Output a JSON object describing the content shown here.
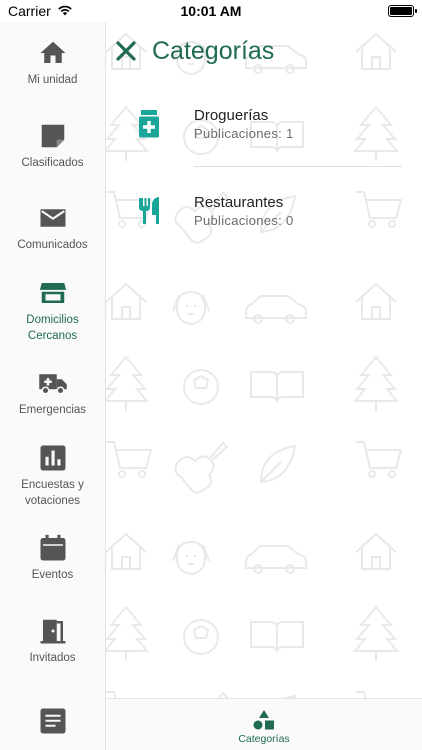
{
  "status_bar": {
    "carrier": "Carrier",
    "time": "10:01 AM",
    "battery_percent": 100
  },
  "sidebar": {
    "items": [
      {
        "label": "Mi unidad",
        "icon": "home-icon",
        "active": false
      },
      {
        "label": "Clasificados",
        "icon": "note-icon",
        "active": false
      },
      {
        "label": "Comunicados",
        "icon": "mail-icon",
        "active": false
      },
      {
        "label": "Domicilios Cercanos",
        "icon": "store-icon",
        "active": true
      },
      {
        "label": "Emergencias",
        "icon": "ambulance-icon",
        "active": false
      },
      {
        "label": "Encuestas y votaciones",
        "icon": "bar-chart-icon",
        "active": false
      },
      {
        "label": "Eventos",
        "icon": "calendar-icon",
        "active": false
      },
      {
        "label": "Invitados",
        "icon": "door-icon",
        "active": false
      },
      {
        "label": "",
        "icon": "document-icon",
        "active": false
      }
    ]
  },
  "header": {
    "title": "Categorías",
    "close_icon": "close-icon"
  },
  "categories": [
    {
      "name": "Droguerías",
      "count_text": "Publicaciones: 1",
      "icon": "pharmacy-icon"
    },
    {
      "name": "Restaurantes",
      "count_text": "Publicaciones: 0",
      "icon": "restaurant-icon"
    }
  ],
  "bottom_nav": {
    "tab_label": "Categorías",
    "icon": "shapes-icon"
  },
  "colors": {
    "accent": "#1f6b53",
    "icon_teal": "#1aa59a",
    "icon_gray": "#555555",
    "pattern": "#e9e9e9"
  }
}
